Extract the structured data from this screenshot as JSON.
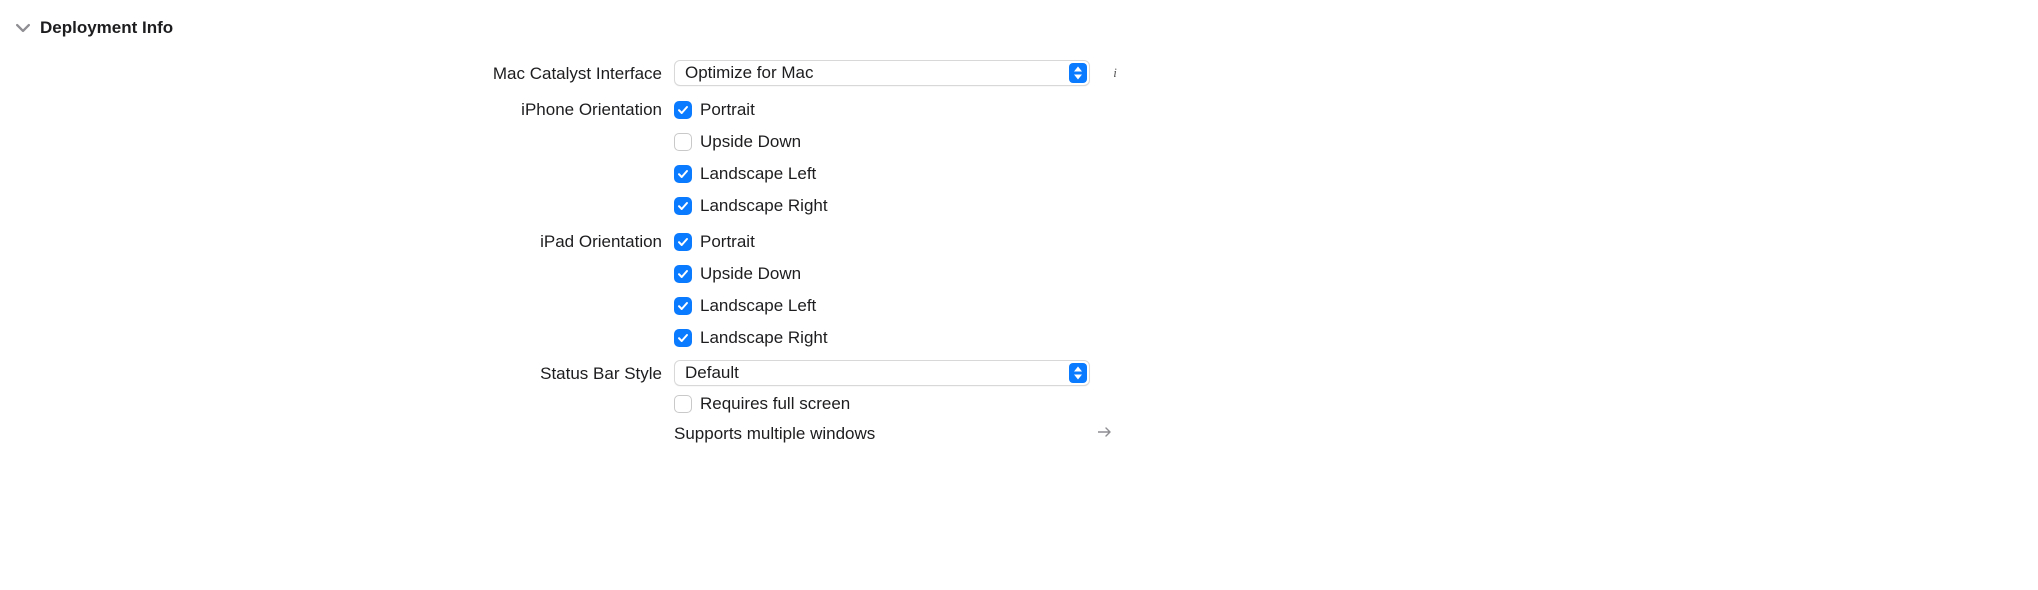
{
  "section": {
    "title": "Deployment Info"
  },
  "macCatalyst": {
    "label": "Mac Catalyst Interface",
    "value": "Optimize for Mac"
  },
  "iphoneOrientation": {
    "label": "iPhone Orientation",
    "options": [
      {
        "name": "portrait",
        "label": "Portrait",
        "checked": true
      },
      {
        "name": "upside-down",
        "label": "Upside Down",
        "checked": false
      },
      {
        "name": "landscape-left",
        "label": "Landscape Left",
        "checked": true
      },
      {
        "name": "landscape-right",
        "label": "Landscape Right",
        "checked": true
      }
    ]
  },
  "ipadOrientation": {
    "label": "iPad Orientation",
    "options": [
      {
        "name": "portrait",
        "label": "Portrait",
        "checked": true
      },
      {
        "name": "upside-down",
        "label": "Upside Down",
        "checked": true
      },
      {
        "name": "landscape-left",
        "label": "Landscape Left",
        "checked": true
      },
      {
        "name": "landscape-right",
        "label": "Landscape Right",
        "checked": true
      }
    ]
  },
  "statusBar": {
    "label": "Status Bar Style",
    "value": "Default",
    "requiresFullScreen": {
      "label": "Requires full screen",
      "checked": false
    },
    "supportsMultipleWindows": {
      "label": "Supports multiple windows"
    }
  }
}
